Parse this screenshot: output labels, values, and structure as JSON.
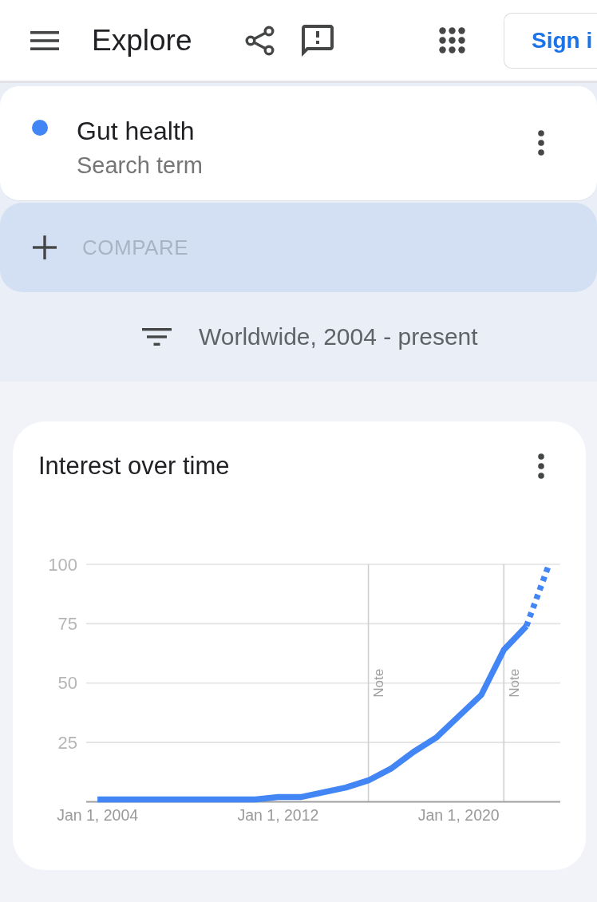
{
  "header": {
    "title": "Explore",
    "sign_in_label": "Sign i"
  },
  "search_terms": [
    {
      "name": "Gut health",
      "subtitle": "Search term",
      "color": "#4285f4"
    }
  ],
  "compare": {
    "label": "COMPARE"
  },
  "filter": {
    "label": "Worldwide, 2004 - present"
  },
  "interest_over_time": {
    "title": "Interest over time",
    "chart_data": {
      "type": "line",
      "categories": [
        "Jan 1, 2004",
        null,
        null,
        null,
        null,
        null,
        null,
        null,
        "Jan 1, 2012",
        null,
        null,
        null,
        null,
        null,
        null,
        null,
        "Jan 1, 2020",
        null,
        null,
        null,
        null
      ],
      "ylim": [
        0,
        100
      ],
      "yticks": [
        25,
        50,
        75,
        100
      ],
      "grid": true,
      "series": [
        {
          "color": "#4285f4",
          "line_style": "solid",
          "values": [
            1,
            1,
            1,
            1,
            1,
            1,
            1,
            1,
            2,
            2,
            4,
            6,
            9,
            14,
            21,
            27,
            36,
            45,
            64,
            74,
            null
          ]
        },
        {
          "color": "#4285f4",
          "line_style": "dashed",
          "values": [
            null,
            null,
            null,
            null,
            null,
            null,
            null,
            null,
            null,
            null,
            null,
            null,
            null,
            null,
            null,
            null,
            null,
            null,
            null,
            74,
            100
          ]
        }
      ],
      "annotations": [
        "Note",
        "Note"
      ]
    }
  }
}
